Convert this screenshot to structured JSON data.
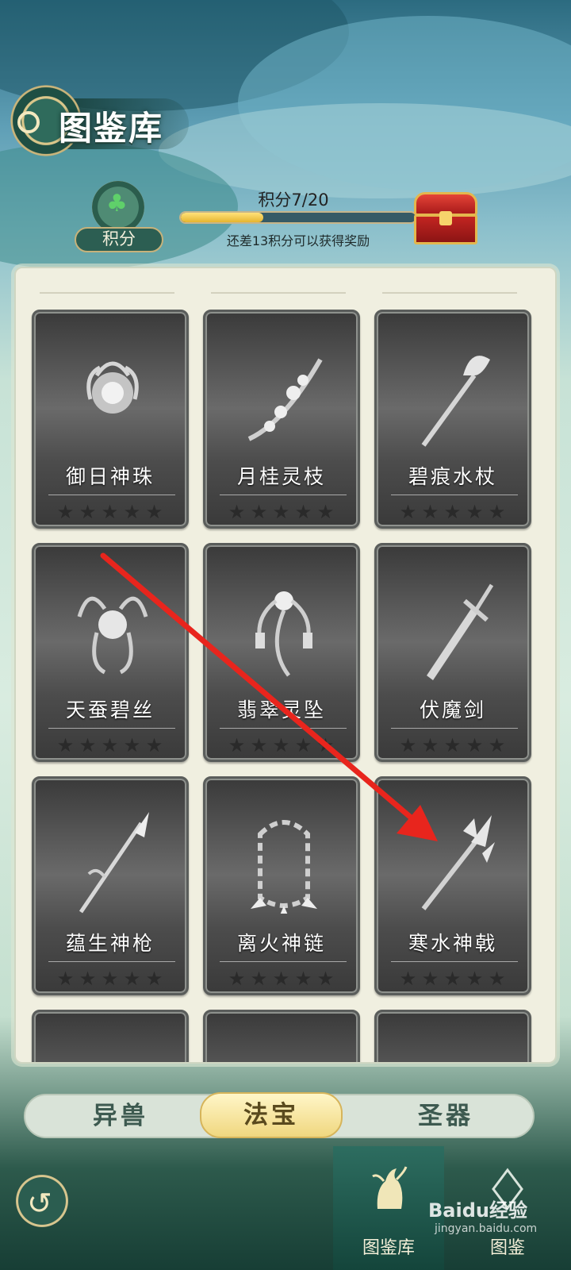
{
  "header": {
    "title": "图鉴库"
  },
  "score": {
    "label": "积分",
    "progress_text": "积分7/20",
    "current": 7,
    "target": 20,
    "note": "还差13积分可以获得奖励"
  },
  "cards": [
    {
      "name": "御日神珠",
      "stars": 5,
      "icon": "orb-icon"
    },
    {
      "name": "月桂灵枝",
      "stars": 5,
      "icon": "branch-icon"
    },
    {
      "name": "碧痕水杖",
      "stars": 5,
      "icon": "staff-icon"
    },
    {
      "name": "天蚕碧丝",
      "stars": 5,
      "icon": "silk-icon"
    },
    {
      "name": "翡翠灵坠",
      "stars": 5,
      "icon": "pendant-icon"
    },
    {
      "name": "伏魔剑",
      "stars": 5,
      "icon": "sword-icon"
    },
    {
      "name": "蕴生神枪",
      "stars": 5,
      "icon": "spear-icon"
    },
    {
      "name": "离火神链",
      "stars": 5,
      "icon": "chain-icon"
    },
    {
      "name": "寒水神戟",
      "stars": 5,
      "icon": "halberd-icon"
    }
  ],
  "tabs": [
    {
      "label": "异兽",
      "active": false
    },
    {
      "label": "法宝",
      "active": true
    },
    {
      "label": "圣器",
      "active": false
    }
  ],
  "nav": {
    "items": [
      {
        "label": "图鉴库",
        "active": true
      },
      {
        "label": "图鉴",
        "active": false
      }
    ]
  },
  "watermark": {
    "text": "Baidu经验",
    "sub": "jingyan.baidu.com"
  },
  "colors": {
    "accent": "#f0d77f",
    "arrow": "#e8251d",
    "card": "#4c4c4c"
  }
}
